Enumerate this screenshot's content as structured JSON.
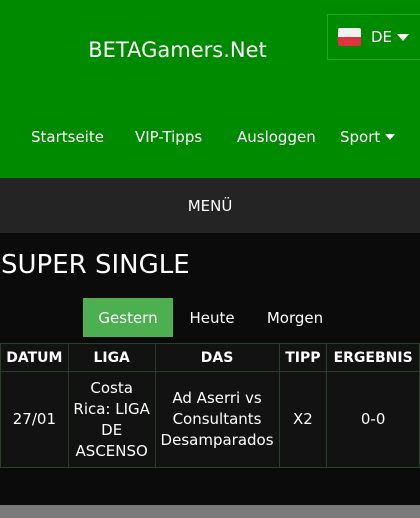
{
  "header": {
    "brand": "BETAGamers.Net",
    "language": {
      "code": "DE",
      "flag": "german-flag-icon"
    },
    "nav": [
      "Startseite",
      "VIP-Tipps",
      "Ausloggen",
      "Sport"
    ]
  },
  "menu_label": "MENÜ",
  "section_title": "SUPER SINGLE",
  "tabs": [
    "Gestern",
    "Heute",
    "Morgen"
  ],
  "table": {
    "headers": [
      "DATUM",
      "LIGA",
      "DAS",
      "TIPP",
      "ERGEBNIS"
    ],
    "rows": [
      [
        "27/01",
        "Costa Rica: LIGA DE ASCENSO",
        "Ad Aserri vs Consultants Desamparados",
        "X2",
        "0-0"
      ]
    ]
  },
  "colors": {
    "header": "#008a00",
    "active_tab": "#4caf50",
    "menubar": "#242424",
    "background": "#0b0b0b"
  }
}
